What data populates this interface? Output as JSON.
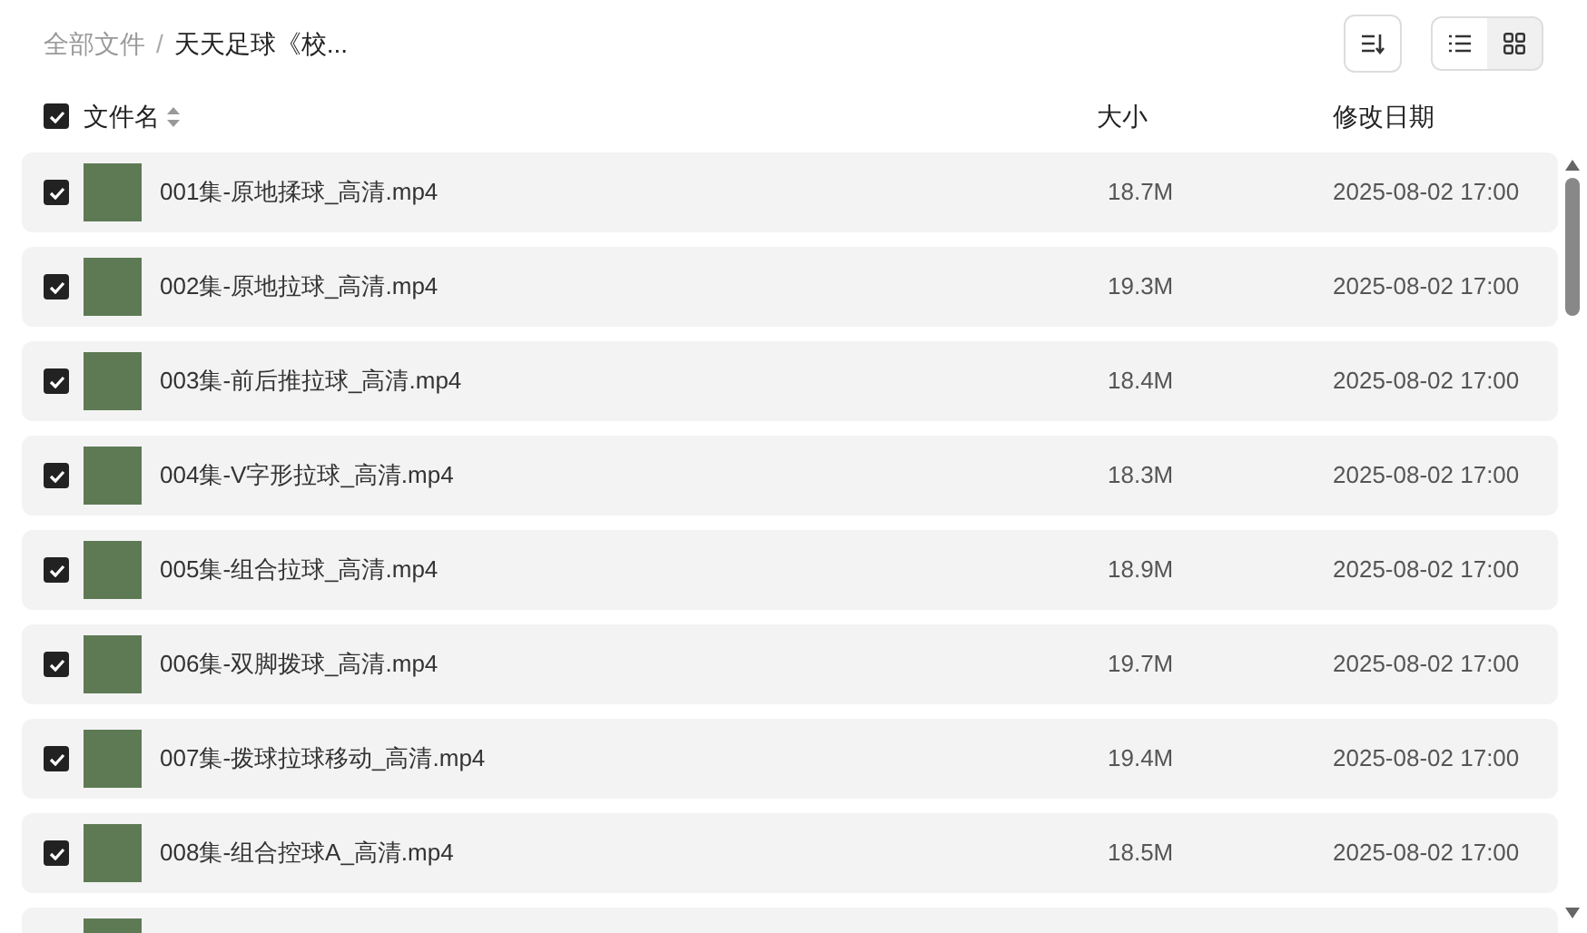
{
  "breadcrumb": [
    {
      "label": "全部文件",
      "current": false
    },
    {
      "label": "天天足球《校...",
      "current": true
    }
  ],
  "view_toggle": [
    {
      "kind": "list",
      "selected": true
    },
    {
      "kind": "grid",
      "selected": false
    }
  ],
  "header": {
    "checked": true,
    "columns": [
      "文件名",
      "大小",
      "修改日期"
    ]
  },
  "rows": [
    {
      "checked": true,
      "name": "001集-原地揉球_高清.mp4",
      "size": "18.7M",
      "modified": "2025-08-02 17:00"
    },
    {
      "checked": true,
      "name": "002集-原地拉球_高清.mp4",
      "size": "19.3M",
      "modified": "2025-08-02 17:00"
    },
    {
      "checked": true,
      "name": "003集-前后推拉球_高清.mp4",
      "size": "18.4M",
      "modified": "2025-08-02 17:00"
    },
    {
      "checked": true,
      "name": "004集-V字形拉球_高清.mp4",
      "size": "18.3M",
      "modified": "2025-08-02 17:00"
    },
    {
      "checked": true,
      "name": "005集-组合拉球_高清.mp4",
      "size": "18.9M",
      "modified": "2025-08-02 17:00"
    },
    {
      "checked": true,
      "name": "006集-双脚拨球_高清.mp4",
      "size": "19.7M",
      "modified": "2025-08-02 17:00"
    },
    {
      "checked": true,
      "name": "007集-拨球拉球移动_高清.mp4",
      "size": "19.4M",
      "modified": "2025-08-02 17:00"
    },
    {
      "checked": true,
      "name": "008集-组合控球A_高清.mp4",
      "size": "18.5M",
      "modified": "2025-08-02 17:00"
    }
  ],
  "breadcrumb_separator": "/"
}
